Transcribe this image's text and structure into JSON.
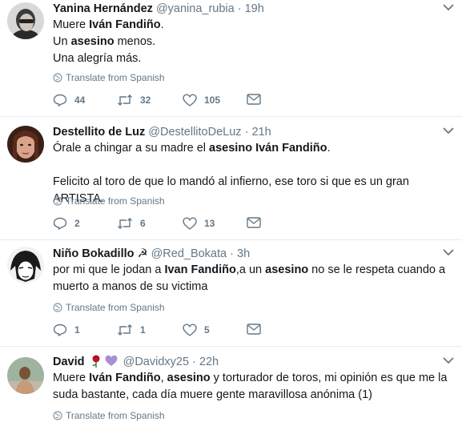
{
  "tweets": [
    {
      "name": "Yanina Hernández",
      "handle": "@yanina_rubia",
      "dot": "·",
      "time": "19h",
      "lines": [
        [
          {
            "t": "Muere ",
            "b": false
          },
          {
            "t": "Iván Fandiño",
            "b": true
          },
          {
            "t": ".",
            "b": false
          }
        ],
        [
          {
            "t": "Un ",
            "b": false
          },
          {
            "t": "asesino",
            "b": true
          },
          {
            "t": " menos.",
            "b": false
          }
        ],
        [
          {
            "t": "Una alegría más.",
            "b": false
          }
        ]
      ],
      "translate": "Translate from Spanish",
      "replies": "44",
      "retweets": "32",
      "likes": "105"
    },
    {
      "name": "Destellito de Luz",
      "handle": "@DestellitoDeLuz",
      "dot": "·",
      "time": "21h",
      "lines": [
        [
          {
            "t": "Órale a chingar a su madre el ",
            "b": false
          },
          {
            "t": "asesino Iván Fandiño",
            "b": true
          },
          {
            "t": ".",
            "b": false
          }
        ],
        [
          {
            "t": "",
            "b": false
          }
        ],
        [
          {
            "t": "Felicito al toro de que lo mandó al infierno, ese toro si que es un gran ARTISTA.",
            "b": false
          }
        ]
      ],
      "translate": "Translate from Spanish",
      "replies": "2",
      "retweets": "6",
      "likes": "13"
    },
    {
      "name": "Niño Bokadillo",
      "name_emoji": "☭",
      "handle": "@Red_Bokata",
      "dot": "·",
      "time": "3h",
      "lines": [
        [
          {
            "t": "por mi que le jodan a ",
            "b": false
          },
          {
            "t": "Ivan Fandiño",
            "b": true
          },
          {
            "t": ",a un ",
            "b": false
          },
          {
            "t": "asesino",
            "b": true
          },
          {
            "t": " no se le respeta cuando a",
            "b": false
          }
        ],
        [
          {
            "t": "muerto a manos de su victima",
            "b": false
          }
        ]
      ],
      "translate": "Translate from Spanish",
      "replies": "1",
      "retweets": "1",
      "likes": "5"
    },
    {
      "name": "David",
      "handle": "@Davidxy25",
      "dot": "·",
      "time": "22h",
      "lines": [
        [
          {
            "t": "Muere ",
            "b": false
          },
          {
            "t": "Iván Fandiño",
            "b": true
          },
          {
            "t": ", ",
            "b": false
          },
          {
            "t": "asesino",
            "b": true
          },
          {
            "t": " y torturador de toros, mi opinión es que me la",
            "b": false
          }
        ],
        [
          {
            "t": "suda bastante, cada día muere gente maravillosa anónima (1)",
            "b": false
          }
        ]
      ],
      "translate": "Translate from Spanish"
    }
  ]
}
